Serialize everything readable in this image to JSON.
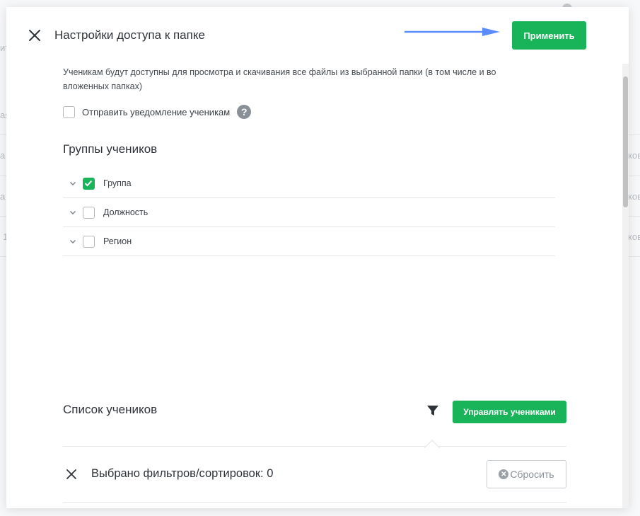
{
  "modal": {
    "title": "Настройки доступа к папке",
    "apply_label": "Применить",
    "description": "Ученикам будут доступны для просмотра и скачивания все файлы из выбранной папки (в том числе и во вложенных папках)",
    "notify_label": "Отправить уведомление ученикам",
    "notify_checked": false,
    "help_glyph": "?"
  },
  "groups": {
    "title": "Группы учеников",
    "items": [
      {
        "label": "Группа",
        "checked": true
      },
      {
        "label": "Должность",
        "checked": false
      },
      {
        "label": "Регион",
        "checked": false
      }
    ]
  },
  "students": {
    "title": "Список учеников",
    "manage_label": "Управлять учениками",
    "filters_text": "Выбрано фильтров/сортировок: 0",
    "reset_label": "Сбросить"
  },
  "background": {
    "fragments": [
      "ит",
      "ая",
      "а",
      "а",
      "1",
      "ков",
      "ков",
      "ков"
    ]
  },
  "colors": {
    "accent_green": "#19b45a",
    "arrow_blue": "#5b8cff",
    "icon_gray": "#8a9097"
  },
  "icons": [
    "close-icon",
    "arrow-icon",
    "help-icon",
    "chevron-down-icon",
    "checkmark-icon",
    "filter-icon",
    "reset-icon"
  ]
}
